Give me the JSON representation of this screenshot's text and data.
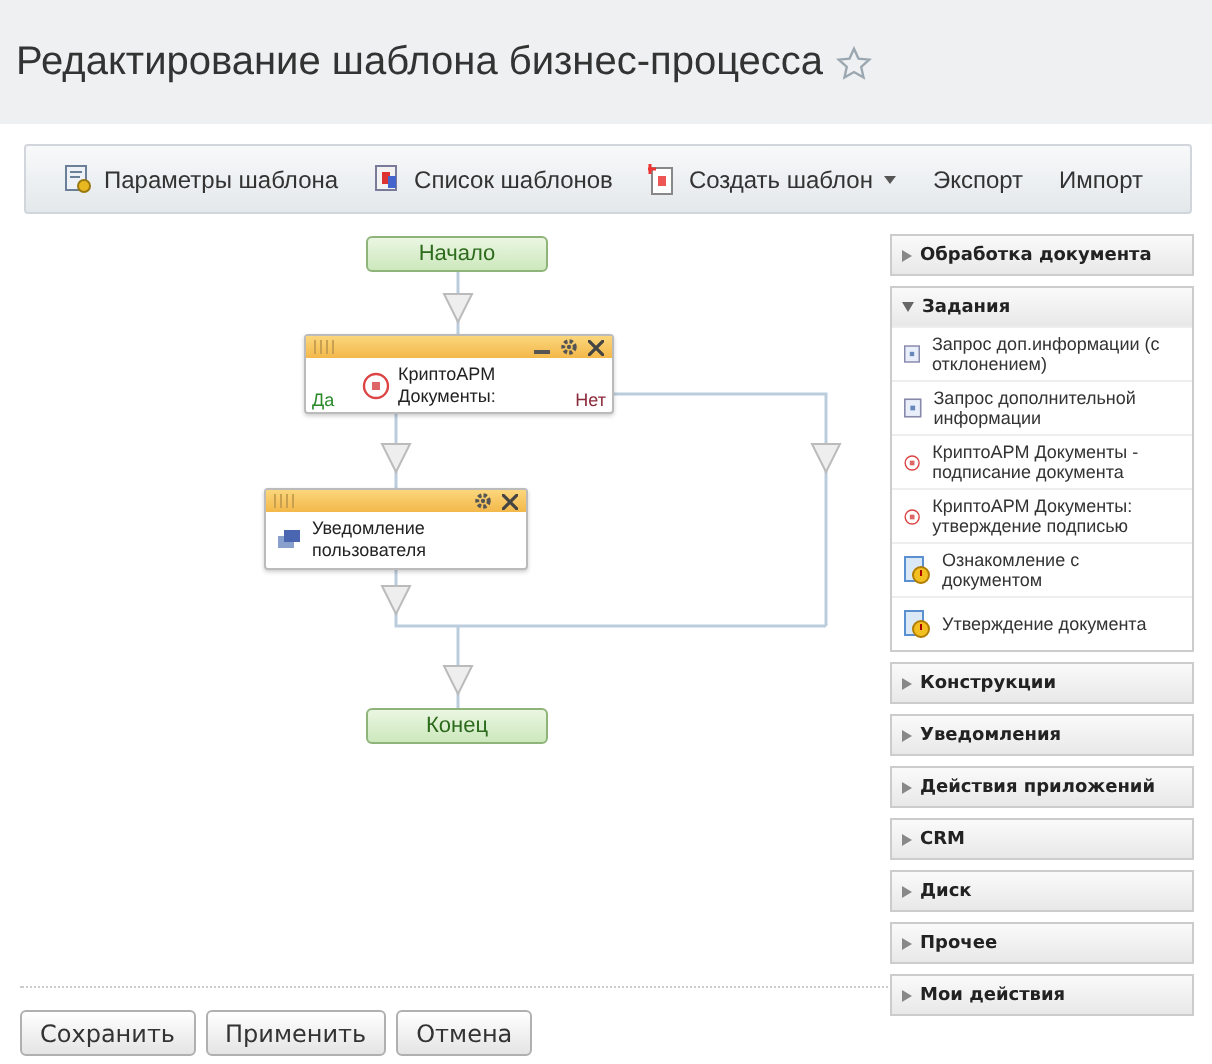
{
  "title": "Редактирование шаблона бизнес-процесса",
  "favorite": false,
  "toolbar": [
    {
      "label": "Параметры шаблона",
      "kind": "settings",
      "dropdown": false
    },
    {
      "label": "Список шаблонов",
      "kind": "list",
      "dropdown": false
    },
    {
      "label": "Создать шаблон",
      "kind": "new",
      "dropdown": true
    },
    {
      "label": "Экспорт",
      "dropdown": false
    },
    {
      "label": "Импорт",
      "dropdown": false
    }
  ],
  "diagram": {
    "start": "Начало",
    "end": "Конец",
    "condition": {
      "title": "КриптоАРМ Документы:",
      "yes": "Да",
      "no": "Нет"
    },
    "notify": {
      "title": "Уведомление пользователя"
    }
  },
  "panel": [
    {
      "title": "Обработка документа",
      "expanded": false
    },
    {
      "title": "Задания",
      "expanded": true,
      "items": [
        {
          "label": "Запрос доп.информации (с отклонением)",
          "kind": "form"
        },
        {
          "label": "Запрос дополнительной информации",
          "kind": "form"
        },
        {
          "label": "КриптоАРМ Документы - подписание документа",
          "kind": "crypto"
        },
        {
          "label": "КриптоАРМ Документы: утверждение подписью",
          "kind": "crypto"
        },
        {
          "label": "Ознакомление с документом",
          "kind": "doc"
        },
        {
          "label": "Утверждение документа",
          "kind": "doc"
        }
      ]
    },
    {
      "title": "Конструкции",
      "expanded": false
    },
    {
      "title": "Уведомления",
      "expanded": false
    },
    {
      "title": "Действия приложений",
      "expanded": false
    },
    {
      "title": "CRM",
      "expanded": false
    },
    {
      "title": "Диск",
      "expanded": false
    },
    {
      "title": "Прочее",
      "expanded": false
    },
    {
      "title": "Мои действия",
      "expanded": false
    }
  ],
  "buttons": [
    "Сохранить",
    "Применить",
    "Отмена"
  ]
}
